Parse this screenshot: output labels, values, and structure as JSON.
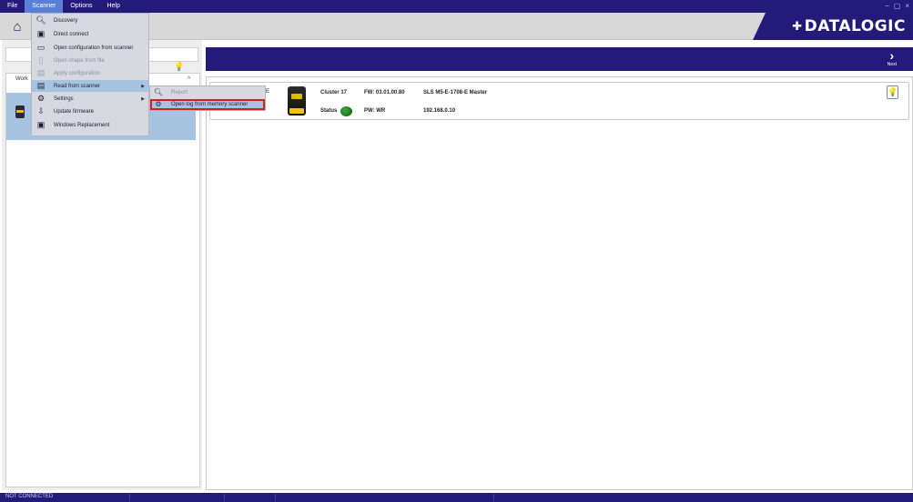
{
  "menubar": {
    "items": [
      "File",
      "Scanner",
      "Options",
      "Help"
    ],
    "active": "Scanner",
    "window_controls": [
      "−",
      "▢",
      "×"
    ]
  },
  "brand": {
    "name": "DATALOGIC",
    "color": "#231a7a"
  },
  "scanner_menu": {
    "items": [
      {
        "label": "Discovery",
        "icon": "search-icon",
        "enabled": true
      },
      {
        "label": "Direct connect",
        "icon": "scanner-icon",
        "enabled": true
      },
      {
        "label": "Open configuration from scanner",
        "icon": "window-icon",
        "enabled": true
      },
      {
        "label": "Open shape from file",
        "icon": "file-icon",
        "enabled": false
      },
      {
        "label": "Apply configuration",
        "icon": "apply-icon",
        "enabled": false
      },
      {
        "label": "Read from scanner",
        "icon": "document-read-icon",
        "enabled": true,
        "highlighted": true,
        "has_submenu": true
      },
      {
        "label": "Settings",
        "icon": "settings-icon",
        "enabled": true,
        "has_submenu": true
      },
      {
        "label": "Update firmware",
        "icon": "firmware-icon",
        "enabled": true
      },
      {
        "label": "Windows Replacement",
        "icon": "replace-icon",
        "enabled": true
      }
    ]
  },
  "read_submenu": {
    "items": [
      {
        "label": "Report",
        "icon": "report-icon",
        "enabled": false
      },
      {
        "label": "Open log from memory scanner",
        "icon": "log-icon",
        "enabled": true,
        "highlighted": true
      }
    ]
  },
  "left": {
    "work_label": "Work",
    "collapse_glyph": "^",
    "bulb_glyph": "💡"
  },
  "nav": {
    "next_label": "Next",
    "next_glyph": "›"
  },
  "device": {
    "name_tail": "-E",
    "cluster": "Cluster 17",
    "fw": "FW: 03.01.00.80",
    "model": "SLS M5-E-1708-E Master",
    "status_label": "Status",
    "pw": "PW: WR",
    "ip": "192.168.0.10",
    "status_color": "#1f7a1f"
  },
  "statusbar": {
    "text": "NOT CONNECTED"
  }
}
